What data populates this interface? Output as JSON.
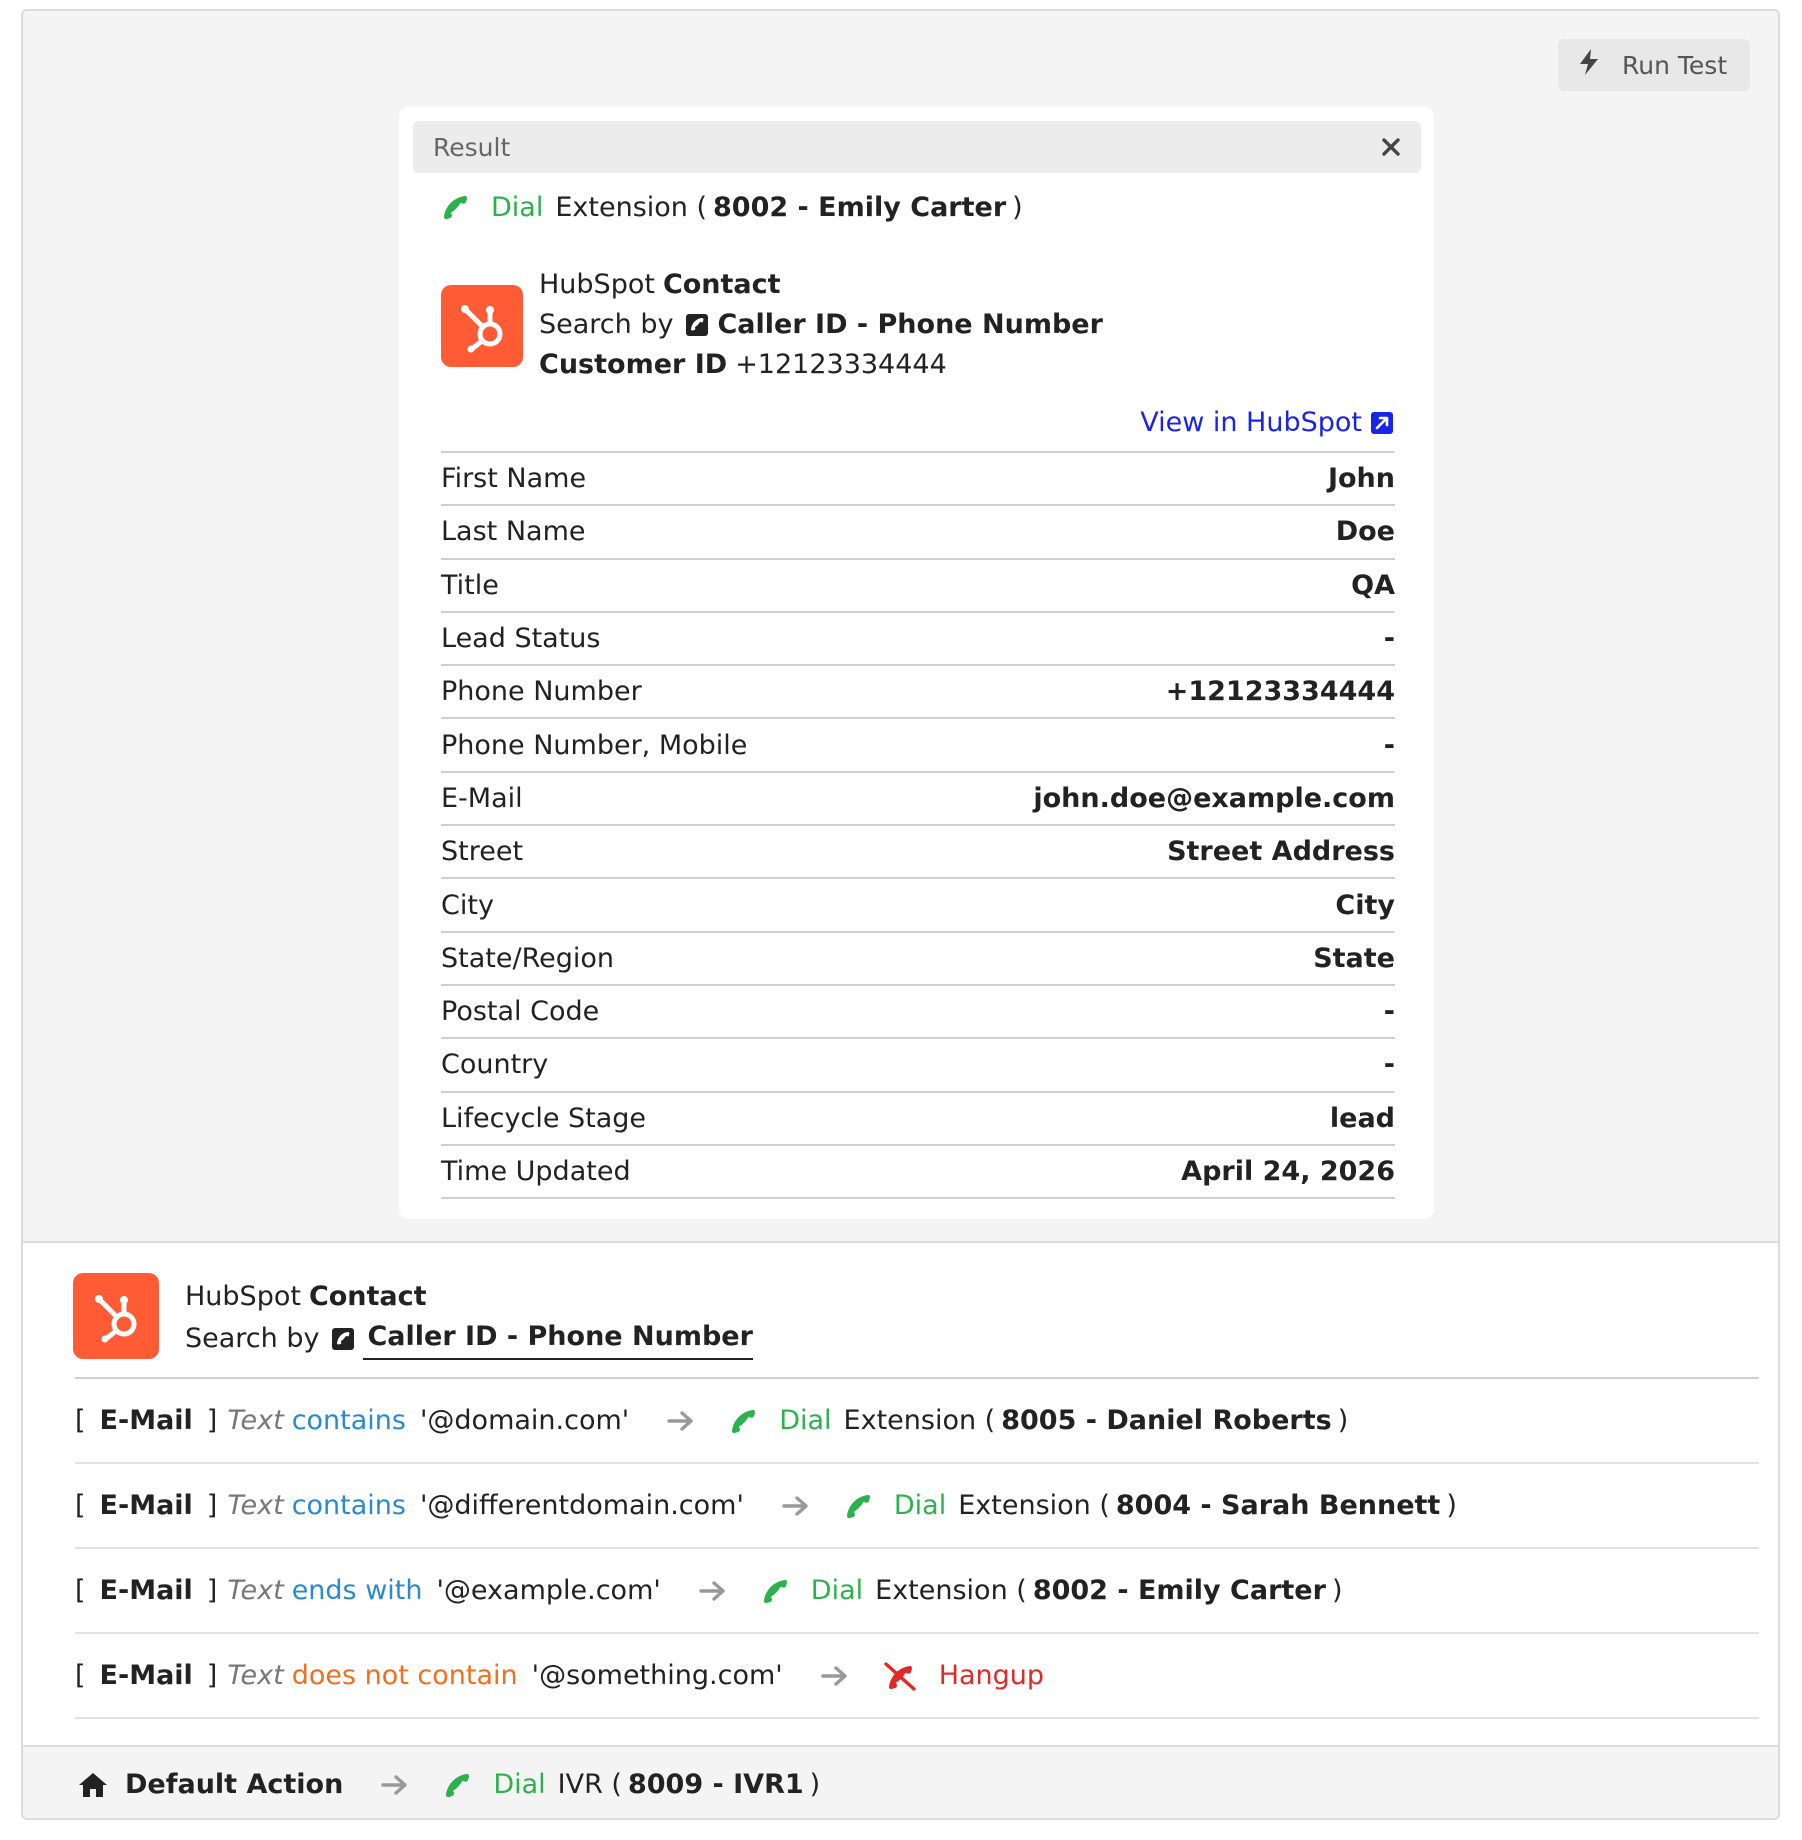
{
  "toolbar": {
    "run_test_label": "Run Test"
  },
  "result": {
    "header_title": "Result",
    "action": {
      "verb": "Dial",
      "target_type": "Extension (",
      "target": "8002 - Emily Carter",
      "suffix": ")"
    },
    "contact": {
      "prefix": "HubSpot",
      "type": "Contact",
      "search_label": "Search by",
      "search_field": "Caller ID - Phone Number",
      "id_label": "Customer ID",
      "id_value": "+12123334444"
    },
    "view_link": "View in HubSpot",
    "fields": [
      {
        "label": "First Name",
        "value": "John"
      },
      {
        "label": "Last Name",
        "value": "Doe"
      },
      {
        "label": "Title",
        "value": "QA"
      },
      {
        "label": "Lead Status",
        "value": "-"
      },
      {
        "label": "Phone Number",
        "value": "+12123334444"
      },
      {
        "label": "Phone Number, Mobile",
        "value": "-"
      },
      {
        "label": "E-Mail",
        "value": "john.doe@example.com"
      },
      {
        "label": "Street",
        "value": "Street Address"
      },
      {
        "label": "City",
        "value": "City"
      },
      {
        "label": "State/Region",
        "value": "State"
      },
      {
        "label": "Postal Code",
        "value": "-"
      },
      {
        "label": "Country",
        "value": "-"
      },
      {
        "label": "Lifecycle Stage",
        "value": "lead"
      },
      {
        "label": "Time Updated",
        "value": "April 24, 2026"
      }
    ]
  },
  "lookup": {
    "prefix": "HubSpot",
    "type": "Contact",
    "search_label": "Search by",
    "search_field": "Caller ID - Phone Number"
  },
  "rules": [
    {
      "open": "[",
      "field": "E-Mail",
      "close": "]",
      "text": "Text",
      "operator": "contains",
      "value": "'@domain.com'",
      "action": "Dial",
      "target_type": "Extension (",
      "target": "8005 - Daniel Roberts",
      "suffix": ")"
    },
    {
      "open": "[",
      "field": "E-Mail",
      "close": "]",
      "text": "Text",
      "operator": "contains",
      "value": "'@differentdomain.com'",
      "action": "Dial",
      "target_type": "Extension (",
      "target": "8004 - Sarah Bennett",
      "suffix": ")"
    },
    {
      "open": "[",
      "field": "E-Mail",
      "close": "]",
      "text": "Text",
      "operator": "ends with",
      "value": "'@example.com'",
      "action": "Dial",
      "target_type": "Extension (",
      "target": "8002 - Emily Carter",
      "suffix": ")"
    },
    {
      "open": "[",
      "field": "E-Mail",
      "close": "]",
      "text": "Text",
      "operator": "does not contain",
      "value": "'@something.com'",
      "action": "Hangup"
    }
  ],
  "default_action": {
    "label": "Default Action",
    "action": "Dial",
    "target_type": "IVR (",
    "target": "8009 - IVR1",
    "suffix": ")"
  },
  "colors": {
    "dial": "#2bb24c",
    "hangup": "#e02a2a",
    "operator_blue": "#2a8ad0",
    "operator_orange": "#f07020",
    "link": "#1a24e8",
    "hubspot": "#ff5c35"
  }
}
